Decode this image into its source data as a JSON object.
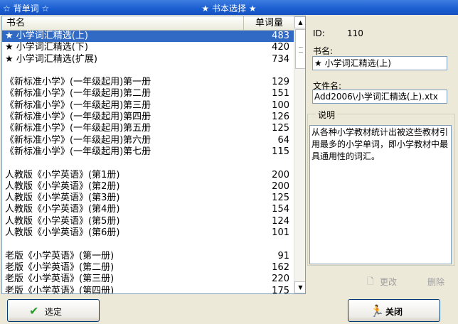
{
  "window": {
    "app_title": "☆ 背单词 ☆",
    "center_title": "★ 书本选择 ★"
  },
  "list": {
    "col_name": "书名",
    "col_count": "单词量",
    "rows": [
      {
        "name": "★  小学词汇精选(上)",
        "count": "483",
        "selected": true
      },
      {
        "name": "★  小学词汇精选(下)",
        "count": "420"
      },
      {
        "name": "★  小学词汇精选(扩展)",
        "count": "734"
      },
      {
        "name": "",
        "count": ""
      },
      {
        "name": "《新标准小学》(一年级起用)第一册",
        "count": "129"
      },
      {
        "name": "《新标准小学》(一年级起用)第二册",
        "count": "151"
      },
      {
        "name": "《新标准小学》(一年级起用)第三册",
        "count": "100"
      },
      {
        "name": "《新标准小学》(一年级起用)第四册",
        "count": "126"
      },
      {
        "name": "《新标准小学》(一年级起用)第五册",
        "count": "125"
      },
      {
        "name": "《新标准小学》(一年级起用)第六册",
        "count": "64"
      },
      {
        "name": "《新标准小学》(一年级起用)第七册",
        "count": "115"
      },
      {
        "name": "",
        "count": ""
      },
      {
        "name": "人教版《小学英语》(第1册)",
        "count": "200"
      },
      {
        "name": "人教版《小学英语》(第2册)",
        "count": "200"
      },
      {
        "name": "人教版《小学英语》(第3册)",
        "count": "125"
      },
      {
        "name": "人教版《小学英语》(第4册)",
        "count": "154"
      },
      {
        "name": "人教版《小学英语》(第5册)",
        "count": "124"
      },
      {
        "name": "人教版《小学英语》(第6册)",
        "count": "101"
      },
      {
        "name": "",
        "count": ""
      },
      {
        "name": "老版《小学英语》(第一册)",
        "count": "91"
      },
      {
        "name": "老版《小学英语》(第二册)",
        "count": "162"
      },
      {
        "name": "老版《小学英语》(第三册)",
        "count": "220"
      },
      {
        "name": "老版《小学英语》(第四册)",
        "count": "175"
      }
    ]
  },
  "details": {
    "id_label": "ID:",
    "id_value": "110",
    "name_label": "书名:",
    "name_value": "★ 小学词汇精选(上)",
    "file_label": "文件名:",
    "file_value": "Add2006\\小学词汇精选(上).xtx",
    "desc_label": "说明",
    "desc_value": "从各种小学教材统计出被这些教材引用最多的小学单词，即小学教材中最具通用性的词汇。"
  },
  "actions": {
    "modify": "更改",
    "delete": "删除",
    "select": "选定",
    "close": "关闭"
  }
}
